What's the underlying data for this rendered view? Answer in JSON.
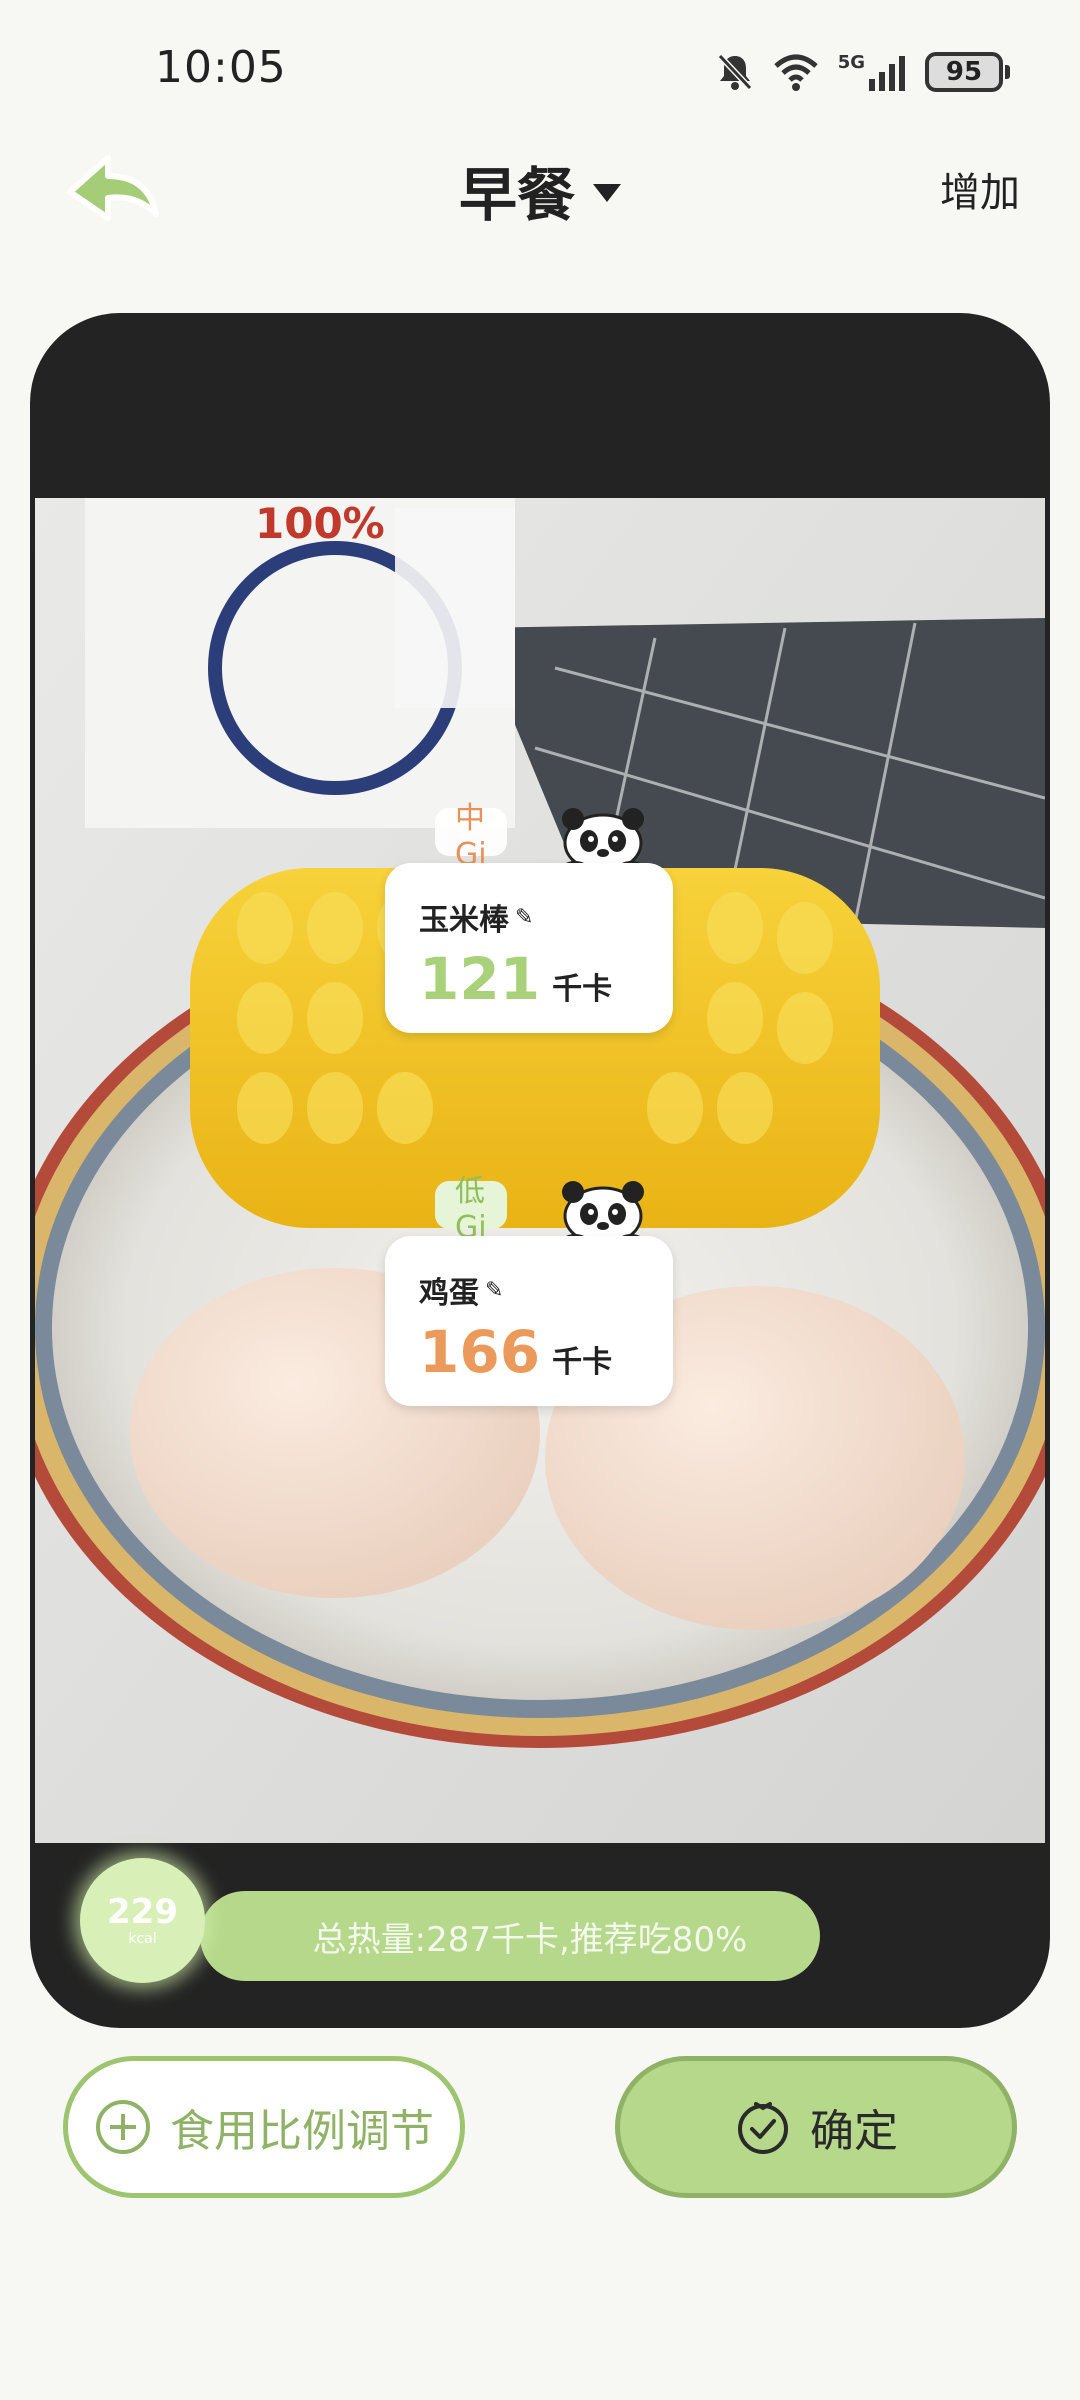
{
  "status_bar": {
    "time": "10:05",
    "network": "5G",
    "battery": "95"
  },
  "header": {
    "title": "早餐",
    "add_label": "增加"
  },
  "foods": [
    {
      "gi": "中Gi",
      "name": "玉米棒",
      "kcal": "121",
      "unit": "千卡",
      "kcal_color": "#a8d17a"
    },
    {
      "gi": "低Gi",
      "name": "鸡蛋",
      "kcal": "166",
      "unit": "千卡",
      "kcal_color": "#ec9a5c"
    }
  ],
  "summary": {
    "circle_value": "229",
    "circle_unit": "kcal",
    "text": "总热量:287千卡,推荐吃80%"
  },
  "buttons": {
    "adjust": "食用比例调节",
    "confirm": "确定"
  },
  "colors": {
    "accent_green": "#b5d88a",
    "border_green": "#9dc46e",
    "card_bg": "#232323"
  },
  "icons": [
    "back-arrow-icon",
    "dropdown-caret-icon",
    "bell-off-icon",
    "wifi-icon",
    "signal-icon",
    "battery-icon",
    "panda-icon",
    "pencil-icon",
    "plus-circle-icon",
    "check-circle-icon"
  ]
}
